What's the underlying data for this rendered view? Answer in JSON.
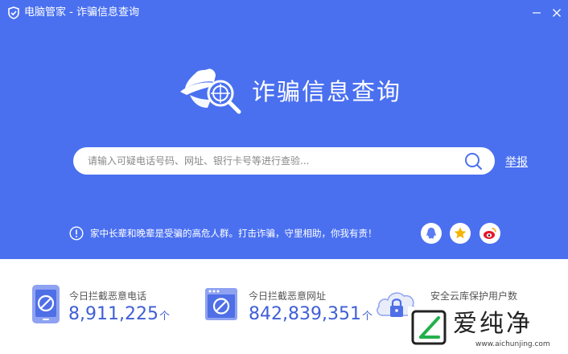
{
  "window": {
    "title": "电脑管家 - 诈骗信息查询",
    "minimize_icon": "minimize-icon",
    "close_icon": "close-icon"
  },
  "hero": {
    "title": "诈骗信息查询",
    "icon": "detective-magnifier-icon"
  },
  "search": {
    "placeholder": "请输入可疑电话号码、网址、银行卡号等进行查验...",
    "value": "",
    "report_label": "举报"
  },
  "notice": {
    "text": "家中长辈和晚辈是受骗的高危人群。打击诈骗，守里相助，你我有责！",
    "share_icons": [
      "qq-icon",
      "qzone-star-icon",
      "weibo-icon"
    ]
  },
  "stats": [
    {
      "label": "今日拦截恶意电话",
      "value": "8,911,225",
      "unit": "个",
      "icon": "phone-block-icon"
    },
    {
      "label": "今日拦截恶意网址",
      "value": "842,839,351",
      "unit": "个",
      "icon": "browser-block-icon"
    },
    {
      "label": "安全云库保护用户数",
      "icon": "cloud-lock-icon"
    }
  ],
  "watermark": {
    "text": "爱纯净",
    "url": "www.aichunjing.com"
  },
  "colors": {
    "header_blue": "#4a70f0",
    "stat_blue": "#3f5fd6",
    "weibo_red": "#e6162d",
    "qzone_yellow": "#f5b400"
  }
}
